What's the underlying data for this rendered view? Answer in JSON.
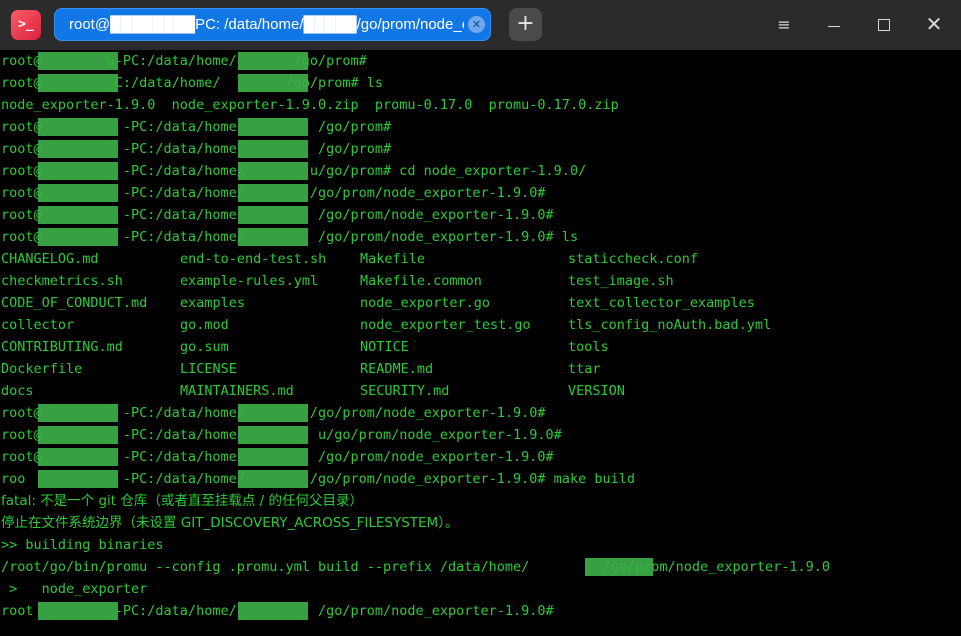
{
  "window": {
    "app_icon": ">_",
    "tab_title": "root@████████PC: /data/home/█████/go/prom/node_expo…",
    "tab_close": "✕",
    "new_tab": "+",
    "menu": "≡",
    "close": "✕"
  },
  "colors": {
    "terminal_text": "#2ccb36",
    "terminal_bg": "#000000",
    "titlebar_bg": "#2b2b2b",
    "active_tab": "#1277e6",
    "redaction": "#3cae48"
  },
  "terminal": {
    "lines": [
      "root@        u-PC:/data/home/       /go/prom#",
      "root@         C:/data/home/        /go/prom# ls",
      "node_exporter-1.9.0  node_exporter-1.9.0.zip  promu-0.17.0  promu-0.17.0.zip",
      "root@          -PC:/data/home          /go/prom#",
      "root@          -PC:/data/home          /go/prom#",
      "root@          -PC:/data/home/        u/go/prom# cd node_exporter-1.9.0/",
      "root@          -PC:/data/home/        /go/prom/node_exporter-1.9.0#",
      "root@          -PC:/data/home          /go/prom/node_exporter-1.9.0#",
      "root@          -PC:/data/home/         /go/prom/node_exporter-1.9.0# ls",
      "",
      "",
      "",
      "",
      "",
      "",
      "",
      "root@          -PC:/data/home/        /go/prom/node_exporter-1.9.0#",
      "root@          -PC:/data/home          u/go/prom/node_exporter-1.9.0#",
      "root@          -PC:/data/home          /go/prom/node_exporter-1.9.0#",
      "roo            -PC:/data/home/        /go/prom/node_exporter-1.9.0# make build",
      "fatal: 不是一个 git 仓库（或者直至挂载点 / 的任何父目录）",
      "停止在文件系统边界（未设置 GIT_DISCOVERY_ACROSS_FILESYSTEM）。",
      ">> building binaries",
      "/root/go/bin/promu --config .promu.yml build --prefix /data/home/         /go/prom/node_exporter-1.9.0",
      " >   node_exporter",
      "root          -PC:/data/home/          /go/prom/node_exporter-1.9.0#"
    ],
    "ls_columns": [
      [
        "CHANGELOG.md",
        "checkmetrics.sh",
        "CODE_OF_CONDUCT.md",
        "collector",
        "CONTRIBUTING.md",
        "Dockerfile",
        "docs"
      ],
      [
        "end-to-end-test.sh",
        "example-rules.yml",
        "examples",
        "go.mod",
        "go.sum",
        "LICENSE",
        "MAINTAINERS.md"
      ],
      [
        "Makefile",
        "Makefile.common",
        "node_exporter.go",
        "node_exporter_test.go",
        "NOTICE",
        "README.md",
        "SECURITY.md"
      ],
      [
        "staticcheck.conf",
        "test_image.sh",
        "text_collector_examples",
        "tls_config_noAuth.bad.yml",
        "tools",
        "ttar",
        "VERSION"
      ]
    ]
  }
}
